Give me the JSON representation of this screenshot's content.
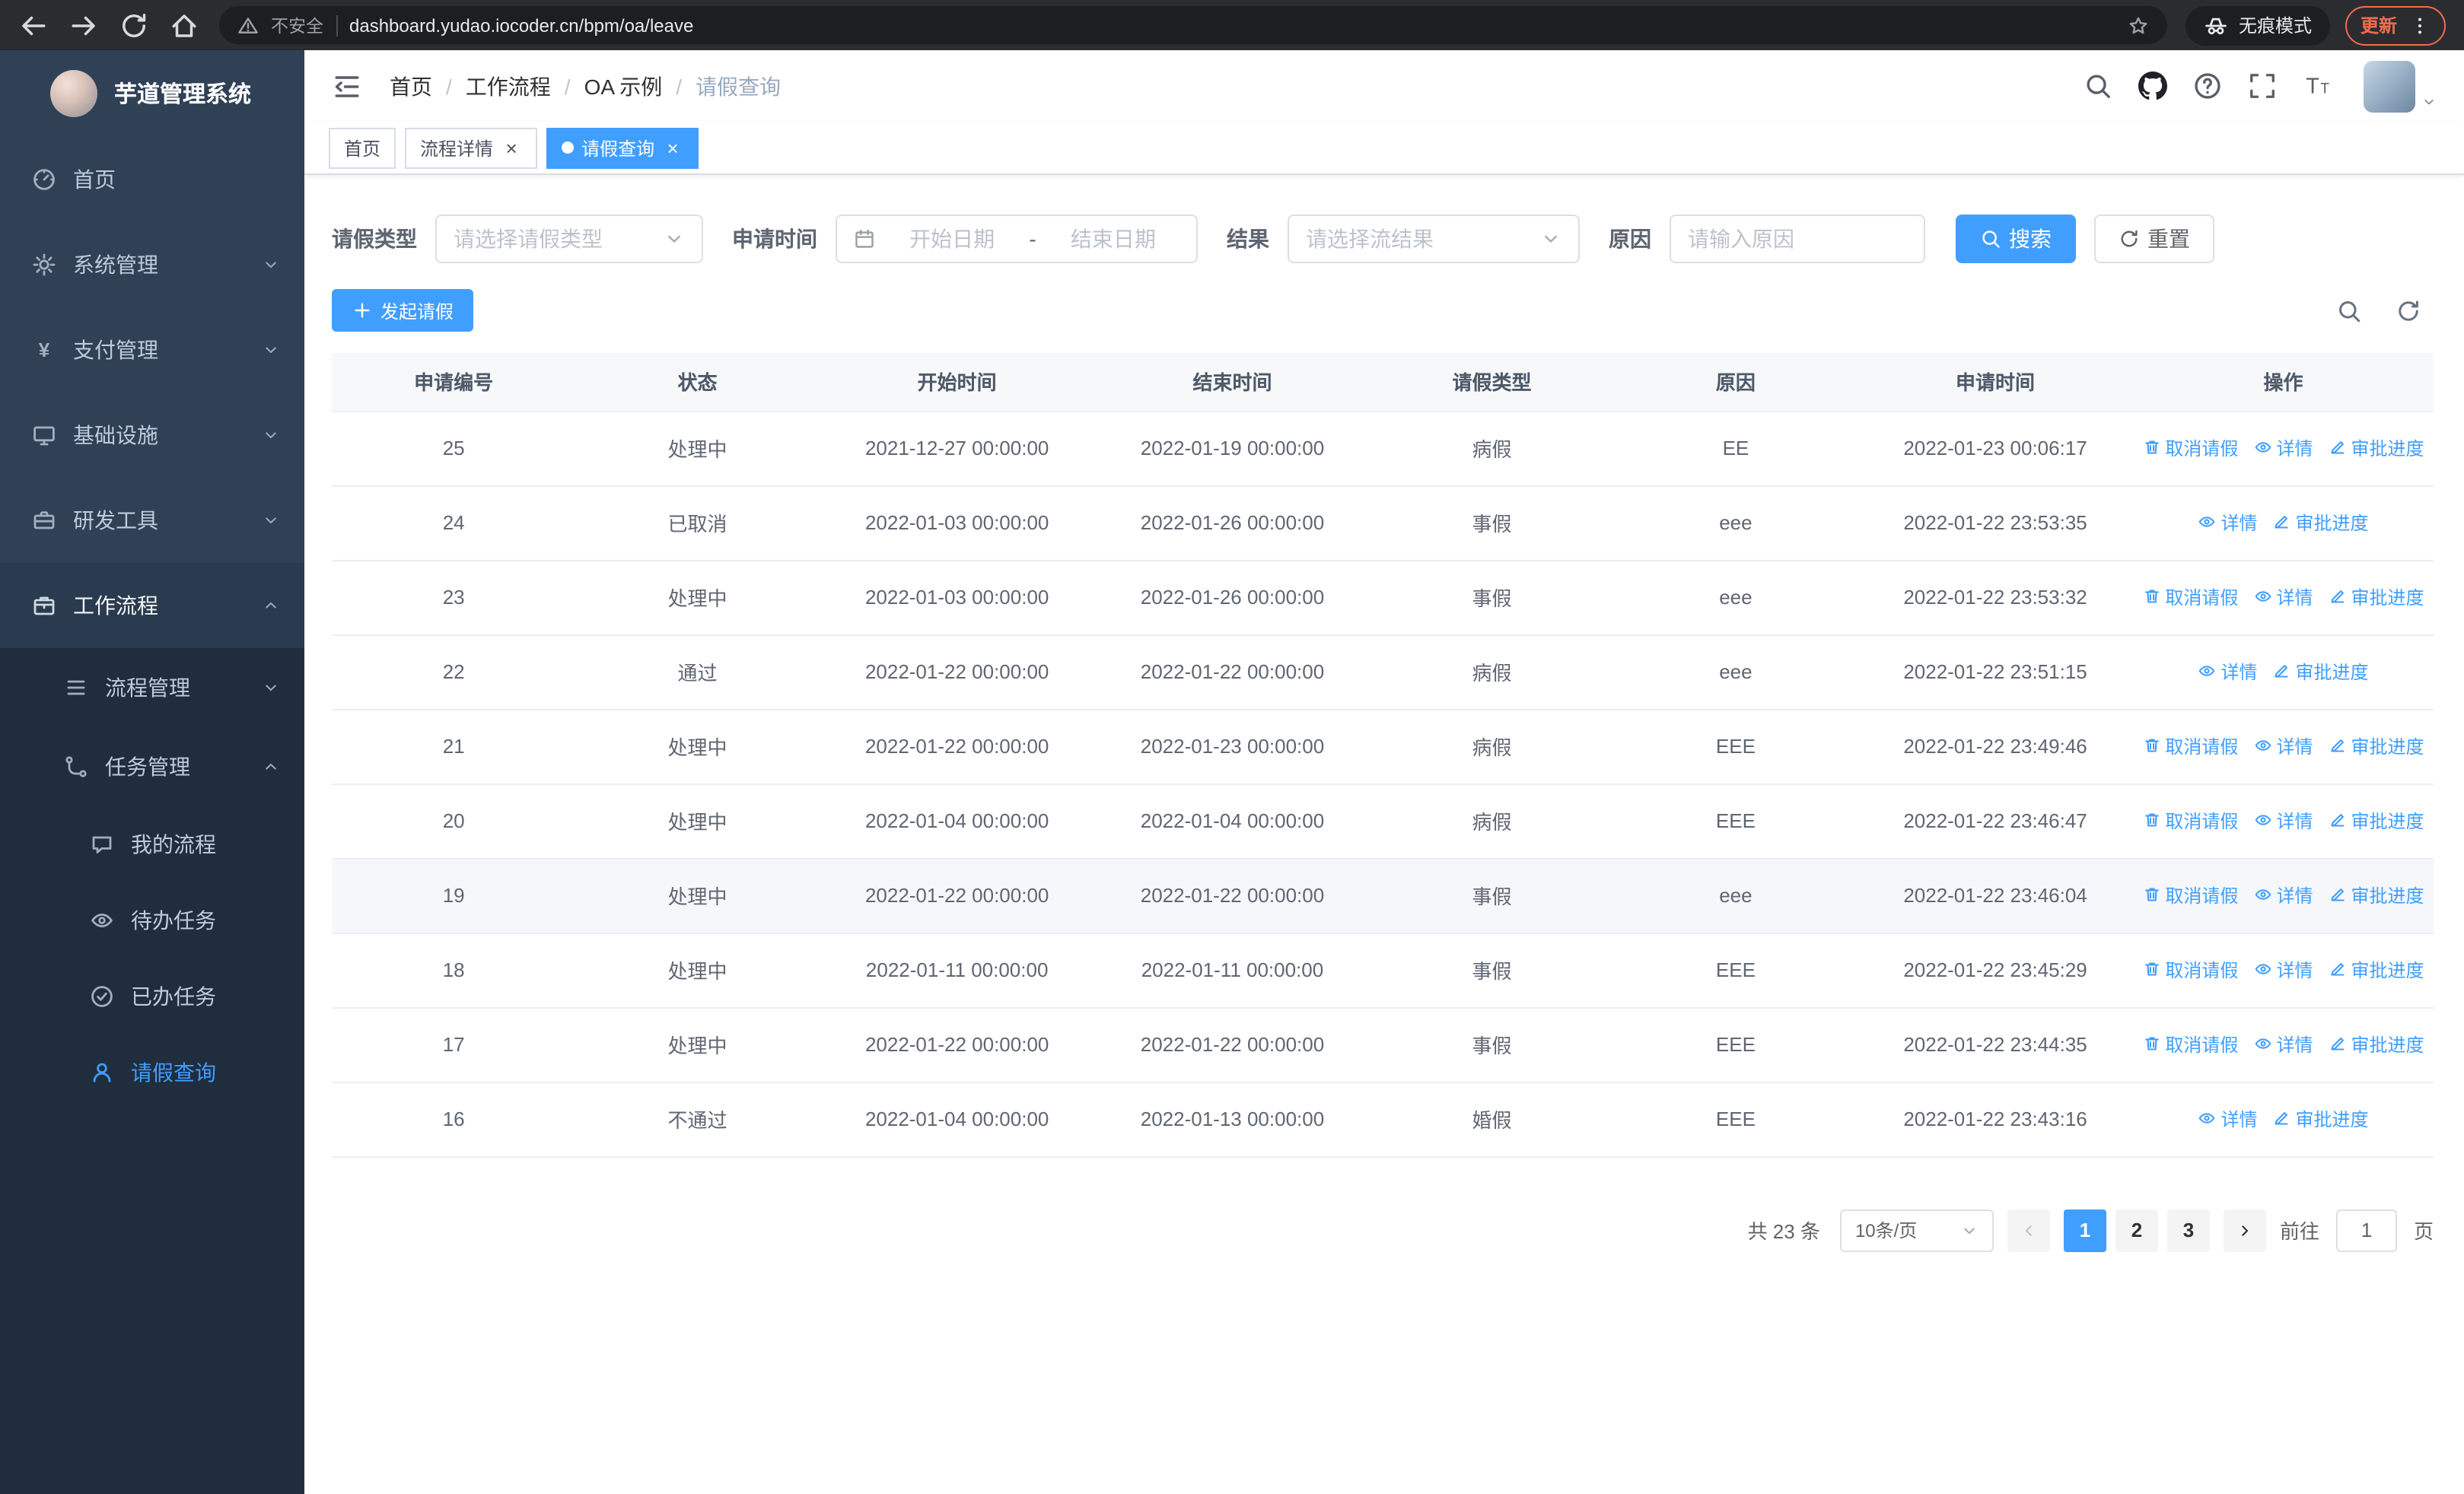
{
  "browser": {
    "security_label": "不安全",
    "url": "dashboard.yudao.iocoder.cn/bpm/oa/leave",
    "incognito_label": "无痕模式",
    "update_label": "更新"
  },
  "sidebar": {
    "app_title": "芋道管理系统",
    "menu": [
      {
        "name": "home",
        "label": "首页",
        "icon": "dashboard",
        "level": 1
      },
      {
        "name": "system",
        "label": "系统管理",
        "icon": "gear",
        "level": 1,
        "arrow": "down"
      },
      {
        "name": "payment",
        "label": "支付管理",
        "icon": "yen",
        "level": 1,
        "arrow": "down"
      },
      {
        "name": "infra",
        "label": "基础设施",
        "icon": "monitor",
        "level": 1,
        "arrow": "down"
      },
      {
        "name": "dev-tools",
        "label": "研发工具",
        "icon": "toolbox",
        "level": 1,
        "arrow": "down"
      },
      {
        "name": "workflow",
        "label": "工作流程",
        "icon": "briefcase",
        "level": 1,
        "arrow": "up",
        "open": true
      },
      {
        "name": "process-mgmt",
        "label": "流程管理",
        "icon": "list",
        "level": 2,
        "arrow": "down"
      },
      {
        "name": "task-mgmt",
        "label": "任务管理",
        "icon": "branch",
        "level": 2,
        "arrow": "up",
        "open": true
      },
      {
        "name": "my-process",
        "label": "我的流程",
        "icon": "chat",
        "level": 3
      },
      {
        "name": "todo-tasks",
        "label": "待办任务",
        "icon": "eye",
        "level": 3
      },
      {
        "name": "done-tasks",
        "label": "已办任务",
        "icon": "check-circle",
        "level": 3
      },
      {
        "name": "leave-query",
        "label": "请假查询",
        "icon": "user",
        "level": 3,
        "active": true
      }
    ]
  },
  "header": {
    "breadcrumb": [
      "首页",
      "工作流程",
      "OA 示例",
      "请假查询"
    ]
  },
  "tabs": [
    {
      "name": "home",
      "label": "首页",
      "closable": false,
      "active": false
    },
    {
      "name": "process-detail",
      "label": "流程详情",
      "closable": true,
      "active": false
    },
    {
      "name": "leave-query",
      "label": "请假查询",
      "closable": true,
      "active": true
    }
  ],
  "filters": {
    "leave_type_label": "请假类型",
    "leave_type_placeholder": "请选择请假类型",
    "apply_time_label": "申请时间",
    "date_start_placeholder": "开始日期",
    "date_separator": "-",
    "date_end_placeholder": "结束日期",
    "result_label": "结果",
    "result_placeholder": "请选择流结果",
    "reason_label": "原因",
    "reason_placeholder": "请输入原因",
    "search_button": "搜索",
    "reset_button": "重置"
  },
  "toolbar": {
    "create_button": "发起请假"
  },
  "table": {
    "headers": [
      "申请编号",
      "状态",
      "开始时间",
      "结束时间",
      "请假类型",
      "原因",
      "申请时间",
      "操作"
    ],
    "op_labels": {
      "cancel": "取消请假",
      "detail": "详情",
      "progress": "审批进度"
    },
    "rows": [
      {
        "id": "25",
        "status": "处理中",
        "start": "2021-12-27 00:00:00",
        "end": "2022-01-19 00:00:00",
        "type": "病假",
        "reason": "EE",
        "applied": "2022-01-23 00:06:17",
        "ops": [
          "cancel",
          "detail",
          "progress"
        ]
      },
      {
        "id": "24",
        "status": "已取消",
        "start": "2022-01-03 00:00:00",
        "end": "2022-01-26 00:00:00",
        "type": "事假",
        "reason": "eee",
        "applied": "2022-01-22 23:53:35",
        "ops": [
          "detail",
          "progress"
        ]
      },
      {
        "id": "23",
        "status": "处理中",
        "start": "2022-01-03 00:00:00",
        "end": "2022-01-26 00:00:00",
        "type": "事假",
        "reason": "eee",
        "applied": "2022-01-22 23:53:32",
        "ops": [
          "cancel",
          "detail",
          "progress"
        ]
      },
      {
        "id": "22",
        "status": "通过",
        "start": "2022-01-22 00:00:00",
        "end": "2022-01-22 00:00:00",
        "type": "病假",
        "reason": "eee",
        "applied": "2022-01-22 23:51:15",
        "ops": [
          "detail",
          "progress"
        ]
      },
      {
        "id": "21",
        "status": "处理中",
        "start": "2022-01-22 00:00:00",
        "end": "2022-01-23 00:00:00",
        "type": "病假",
        "reason": "EEE",
        "applied": "2022-01-22 23:49:46",
        "ops": [
          "cancel",
          "detail",
          "progress"
        ]
      },
      {
        "id": "20",
        "status": "处理中",
        "start": "2022-01-04 00:00:00",
        "end": "2022-01-04 00:00:00",
        "type": "病假",
        "reason": "EEE",
        "applied": "2022-01-22 23:46:47",
        "ops": [
          "cancel",
          "detail",
          "progress"
        ]
      },
      {
        "id": "19",
        "status": "处理中",
        "start": "2022-01-22 00:00:00",
        "end": "2022-01-22 00:00:00",
        "type": "事假",
        "reason": "eee",
        "applied": "2022-01-22 23:46:04",
        "ops": [
          "cancel",
          "detail",
          "progress"
        ],
        "highlight": true
      },
      {
        "id": "18",
        "status": "处理中",
        "start": "2022-01-11 00:00:00",
        "end": "2022-01-11 00:00:00",
        "type": "事假",
        "reason": "EEE",
        "applied": "2022-01-22 23:45:29",
        "ops": [
          "cancel",
          "detail",
          "progress"
        ]
      },
      {
        "id": "17",
        "status": "处理中",
        "start": "2022-01-22 00:00:00",
        "end": "2022-01-22 00:00:00",
        "type": "事假",
        "reason": "EEE",
        "applied": "2022-01-22 23:44:35",
        "ops": [
          "cancel",
          "detail",
          "progress"
        ]
      },
      {
        "id": "16",
        "status": "不通过",
        "start": "2022-01-04 00:00:00",
        "end": "2022-01-13 00:00:00",
        "type": "婚假",
        "reason": "EEE",
        "applied": "2022-01-22 23:43:16",
        "ops": [
          "detail",
          "progress"
        ]
      }
    ]
  },
  "pagination": {
    "total_text": "共 23 条",
    "page_size": "10条/页",
    "pages": [
      "1",
      "2",
      "3"
    ],
    "active_page": "1",
    "goto_prefix": "前往",
    "goto_value": "1",
    "goto_suffix": "页"
  },
  "colors": {
    "primary": "#409eff",
    "sidebar_bg": "#304156",
    "sidebar_submenu_bg": "#1f2d3d",
    "update_badge": "#ef6c4f"
  }
}
